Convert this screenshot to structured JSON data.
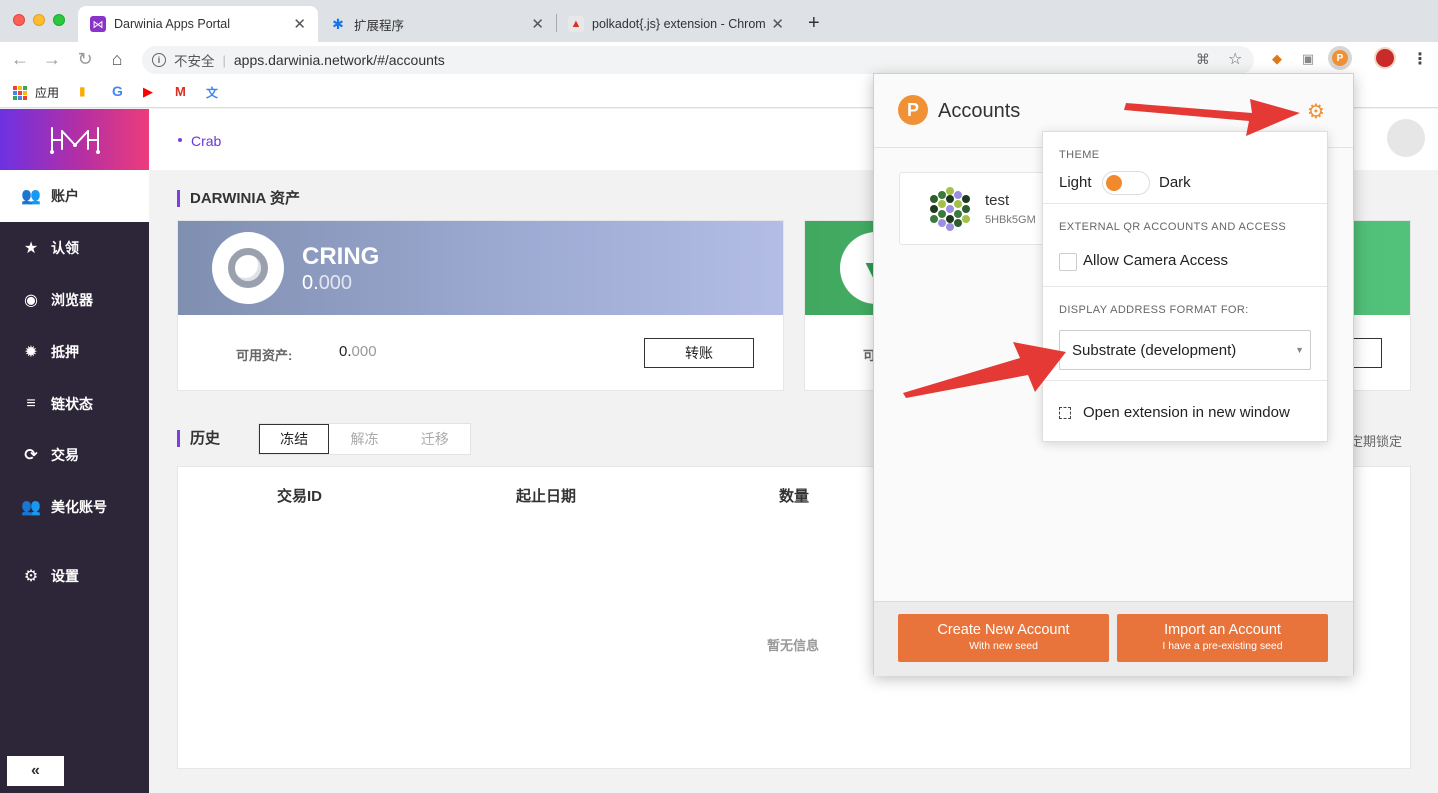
{
  "browser": {
    "tabs": [
      {
        "title": "Darwinia Apps Portal",
        "close": "✕"
      },
      {
        "title": "扩展程序",
        "close": "✕"
      },
      {
        "title": "polkadot{.js} extension - Chrom",
        "close": "✕"
      }
    ],
    "new_tab": "+",
    "security_label": "不安全",
    "url": "apps.darwinia.network/#/accounts",
    "bookmarks": {
      "apps": "应用"
    }
  },
  "sidebar": {
    "items": [
      {
        "label": "账户",
        "icon": "users-icon"
      },
      {
        "label": "认领",
        "icon": "star-icon"
      },
      {
        "label": "浏览器",
        "icon": "target-icon"
      },
      {
        "label": "抵押",
        "icon": "cog-icon"
      },
      {
        "label": "链状态",
        "icon": "database-icon"
      },
      {
        "label": "交易",
        "icon": "refresh-icon"
      },
      {
        "label": "美化账号",
        "icon": "users-icon"
      },
      {
        "label": "设置",
        "icon": "cogs-icon"
      }
    ],
    "collapse": "«"
  },
  "header": {
    "network": "Crab"
  },
  "assets": {
    "title": "DARWINIA 资产",
    "cring": {
      "name": "CRING",
      "amount_int": "0.",
      "amount_dec": "000",
      "available_label": "可用资产:",
      "available_int": "0.",
      "available_dec": "000",
      "transfer": "转账"
    },
    "partial_label": "可"
  },
  "history": {
    "title": "历史",
    "tabs": [
      "冻结",
      "解冻",
      "迁移"
    ],
    "right_text": "定期锁定",
    "columns": [
      "交易ID",
      "起止日期",
      "数量"
    ],
    "empty": "暂无信息"
  },
  "extension": {
    "title": "Accounts",
    "account": {
      "name": "test",
      "address": "5HBk5GM"
    },
    "menu": {
      "theme_label": "THEME",
      "light": "Light",
      "dark": "Dark",
      "qr_label": "EXTERNAL QR ACCOUNTS AND ACCESS",
      "camera": "Allow Camera Access",
      "format_label": "DISPLAY ADDRESS FORMAT FOR:",
      "format_value": "Substrate (development)",
      "open_window": "Open extension in new window"
    },
    "create": {
      "title": "Create New Account",
      "sub": "With new seed"
    },
    "import": {
      "title": "Import an Account",
      "sub": "I have a pre-existing seed"
    }
  },
  "colors": {
    "accent": "#7b3fe4",
    "polkadot_orange": "#e8743b",
    "sidebar_bg": "#2c2638",
    "arrow": "#e53935"
  }
}
